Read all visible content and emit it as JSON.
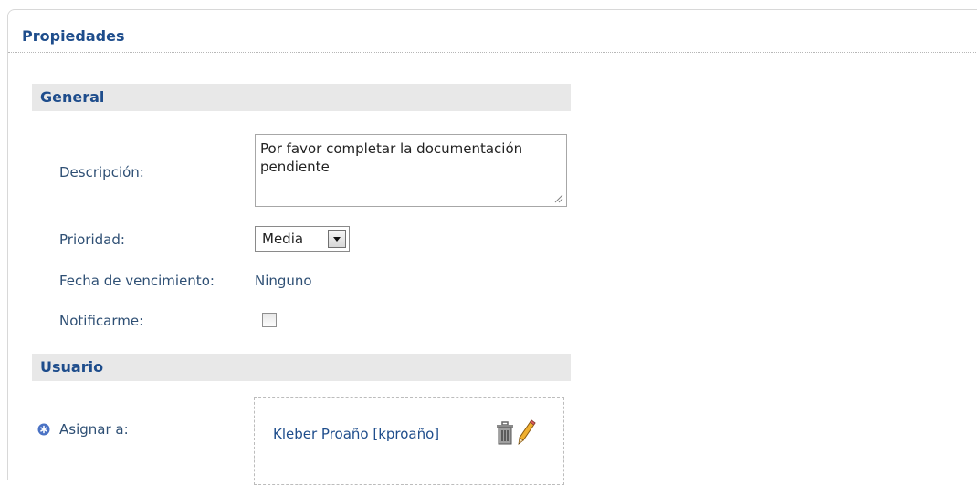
{
  "panel": {
    "title": "Propiedades"
  },
  "general": {
    "header": "General",
    "descripcion": {
      "label": "Descripción:",
      "value": "Por favor completar la documentación pendiente"
    },
    "prioridad": {
      "label": "Prioridad:",
      "selected": "Media"
    },
    "fecha": {
      "label": "Fecha de vencimiento:",
      "value": "Ninguno"
    },
    "notificar": {
      "label": "Notificarme:",
      "checked": false
    }
  },
  "usuario": {
    "header": "Usuario",
    "asignar": {
      "label": "Asignar a:",
      "assignee": "Kleber Proaño [kproaño]"
    }
  },
  "icons": {
    "required": "asterisk-circle-icon",
    "delete": "trash-icon",
    "edit": "pencil-icon",
    "dropdown": "chevron-down-icon",
    "resize": "resize-grip-icon"
  },
  "colors": {
    "heading": "#1e4d8c",
    "label": "#2e4f74",
    "section_bg": "#e8e8e8",
    "required_icon": "#4a72c4"
  }
}
